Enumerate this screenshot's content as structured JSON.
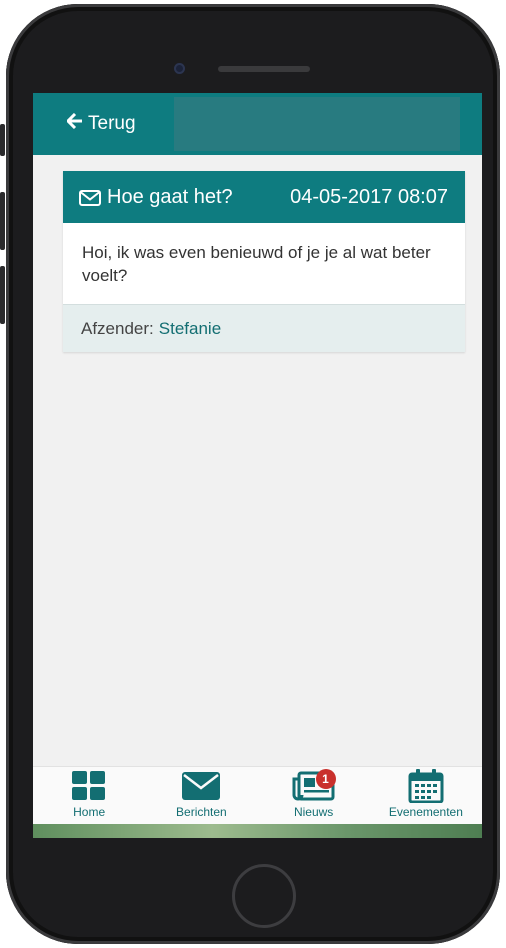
{
  "header": {
    "back_label": "Terug"
  },
  "message": {
    "subject": "Hoe gaat het?",
    "datetime": "04-05-2017 08:07",
    "body": "Hoi, ik was even benieuwd of je je al wat beter voelt?",
    "sender_label": "Afzender:",
    "sender_name": "Stefanie"
  },
  "nav": {
    "items": [
      {
        "label": "Home",
        "icon": "grid-icon"
      },
      {
        "label": "Berichten",
        "icon": "envelope-icon"
      },
      {
        "label": "Nieuws",
        "icon": "newspaper-icon",
        "badge": "1"
      },
      {
        "label": "Evenementen",
        "icon": "calendar-icon"
      }
    ]
  },
  "colors": {
    "accent": "#0e7c80",
    "footer_bg": "#e5eeee",
    "badge": "#c9302c"
  }
}
